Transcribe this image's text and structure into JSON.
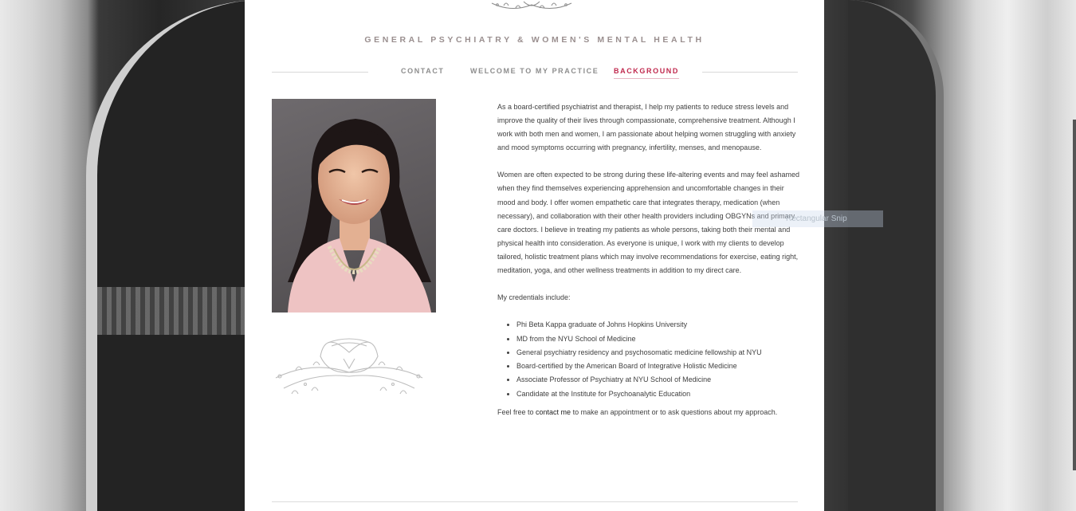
{
  "site": {
    "title": "GENERAL PSYCHIATRY & WOMEN'S MENTAL HEALTH"
  },
  "nav": {
    "items": [
      {
        "label": "CONTACT",
        "active": false
      },
      {
        "label": "WELCOME TO MY PRACTICE",
        "active": false
      },
      {
        "label": "BACKGROUND",
        "active": true
      }
    ]
  },
  "content": {
    "para1": "As a board-certified psychiatrist and therapist, I help my patients to reduce stress levels and improve the quality of their lives through compassionate, comprehensive treatment. Although I work with both men and women, I am passionate about helping women struggling with anxiety and mood symptoms occurring with pregnancy, infertility, menses, and menopause.",
    "para2": "Women are often expected to be strong during these life-altering events and may feel ashamed when they find themselves experiencing apprehension and uncomfortable changes in their mood and body. I offer women empathetic care that integrates therapy, medication (when necessary), and collaboration with their other health providers including OBGYNs and primary care doctors. I believe in treating my patients as whole persons, taking both their mental and physical health into consideration. As everyone is unique, I work with my clients to develop tailored, holistic treatment plans which may involve recommendations for exercise, eating right, meditation, yoga, and other wellness treatments in addition to my direct care.",
    "credentials_intro": "My credentials include:",
    "credentials": [
      "Phi Beta Kappa graduate of Johns Hopkins University",
      "MD from the NYU School of Medicine",
      "General psychiatry residency and psychosomatic medicine fellowship at NYU",
      "Board-certified by the American Board of Integrative Holistic Medicine",
      "Associate Professor of Psychiatry at NYU School of Medicine",
      "Candidate at the Institute for Psychoanalytic Education"
    ],
    "closing_before": "Feel free to ",
    "closing_link": "contact me",
    "closing_after": " to make an appointment or to ask questions about my approach."
  },
  "overlay": {
    "snip_label": "Rectangular Snip"
  },
  "colors": {
    "accent": "#c0284d",
    "nav": "#8d8d8d",
    "title": "#9a8f8f"
  }
}
